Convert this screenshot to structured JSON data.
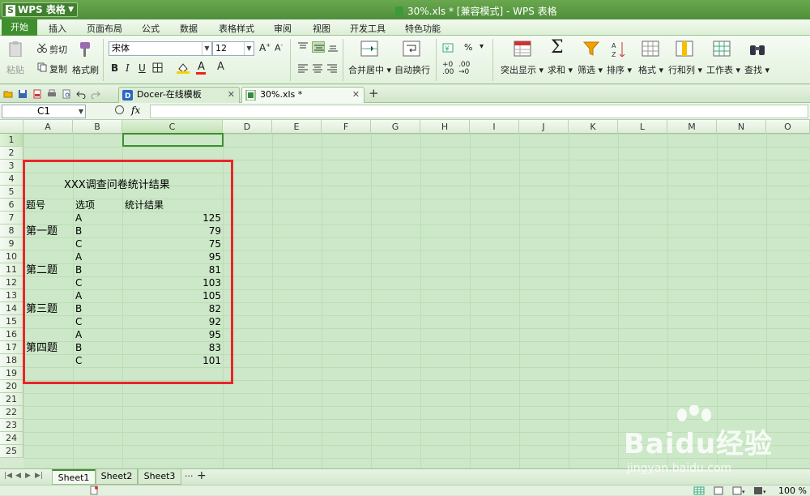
{
  "titlebar": {
    "app_button": "WPS 表格",
    "window_title": "30%.xls * [兼容模式] - WPS 表格"
  },
  "menu": [
    "开始",
    "插入",
    "页面布局",
    "公式",
    "数据",
    "表格样式",
    "审阅",
    "视图",
    "开发工具",
    "特色功能"
  ],
  "ribbon": {
    "paste": "粘贴",
    "cut": "剪切",
    "copy": "复制",
    "format_painter": "格式刷",
    "font_name": "宋体",
    "font_size": "12",
    "bold": "B",
    "italic": "I",
    "underline": "U",
    "merge_center": "合并居中",
    "wrap_text": "自动换行",
    "percent": "%",
    "decimals_inc": ".00",
    "decimals_dec": ".00",
    "highlight": "突出显示",
    "sum": "求和",
    "filter": "筛选",
    "sort": "排序",
    "format": "格式",
    "row_col": "行和列",
    "worksheet": "工作表",
    "find": "查找"
  },
  "tabs": [
    {
      "label": "Docer-在线模板"
    },
    {
      "label": "30%.xls *"
    }
  ],
  "formula": {
    "name_box": "C1",
    "fx": "fx"
  },
  "columns": [
    "A",
    "B",
    "C",
    "D",
    "E",
    "F",
    "G",
    "H",
    "I",
    "J",
    "K",
    "L",
    "M",
    "N",
    "O"
  ],
  "rows": [
    "1",
    "2",
    "3",
    "4",
    "5",
    "6",
    "7",
    "8",
    "9",
    "10",
    "11",
    "12",
    "13",
    "14",
    "15",
    "16",
    "17",
    "18",
    "19",
    "20",
    "21",
    "22",
    "23",
    "24",
    "25"
  ],
  "sheet": {
    "title": "XXX调查问卷统计结果",
    "headers": [
      "题号",
      "选项",
      "统计结果"
    ],
    "questions": [
      "第一题",
      "第二题",
      "第三题",
      "第四题"
    ],
    "data": [
      {
        "option": "A",
        "value": "125"
      },
      {
        "option": "B",
        "value": "79"
      },
      {
        "option": "C",
        "value": "75"
      },
      {
        "option": "A",
        "value": "95"
      },
      {
        "option": "B",
        "value": "81"
      },
      {
        "option": "C",
        "value": "103"
      },
      {
        "option": "A",
        "value": "105"
      },
      {
        "option": "B",
        "value": "82"
      },
      {
        "option": "C",
        "value": "92"
      },
      {
        "option": "A",
        "value": "95"
      },
      {
        "option": "B",
        "value": "83"
      },
      {
        "option": "C",
        "value": "101"
      }
    ]
  },
  "sheet_tabs": [
    "Sheet1",
    "Sheet2",
    "Sheet3"
  ],
  "sheet_more": "···",
  "sheet_add": "+",
  "status": {
    "zoom": "100 %"
  },
  "watermark": {
    "brand": "Baidu经验",
    "url": "jingyan.baidu.com"
  },
  "colors": {
    "accent": "#3f8f2f",
    "grid_bg": "#cce8c8",
    "highlight_box": "#e8262a"
  }
}
